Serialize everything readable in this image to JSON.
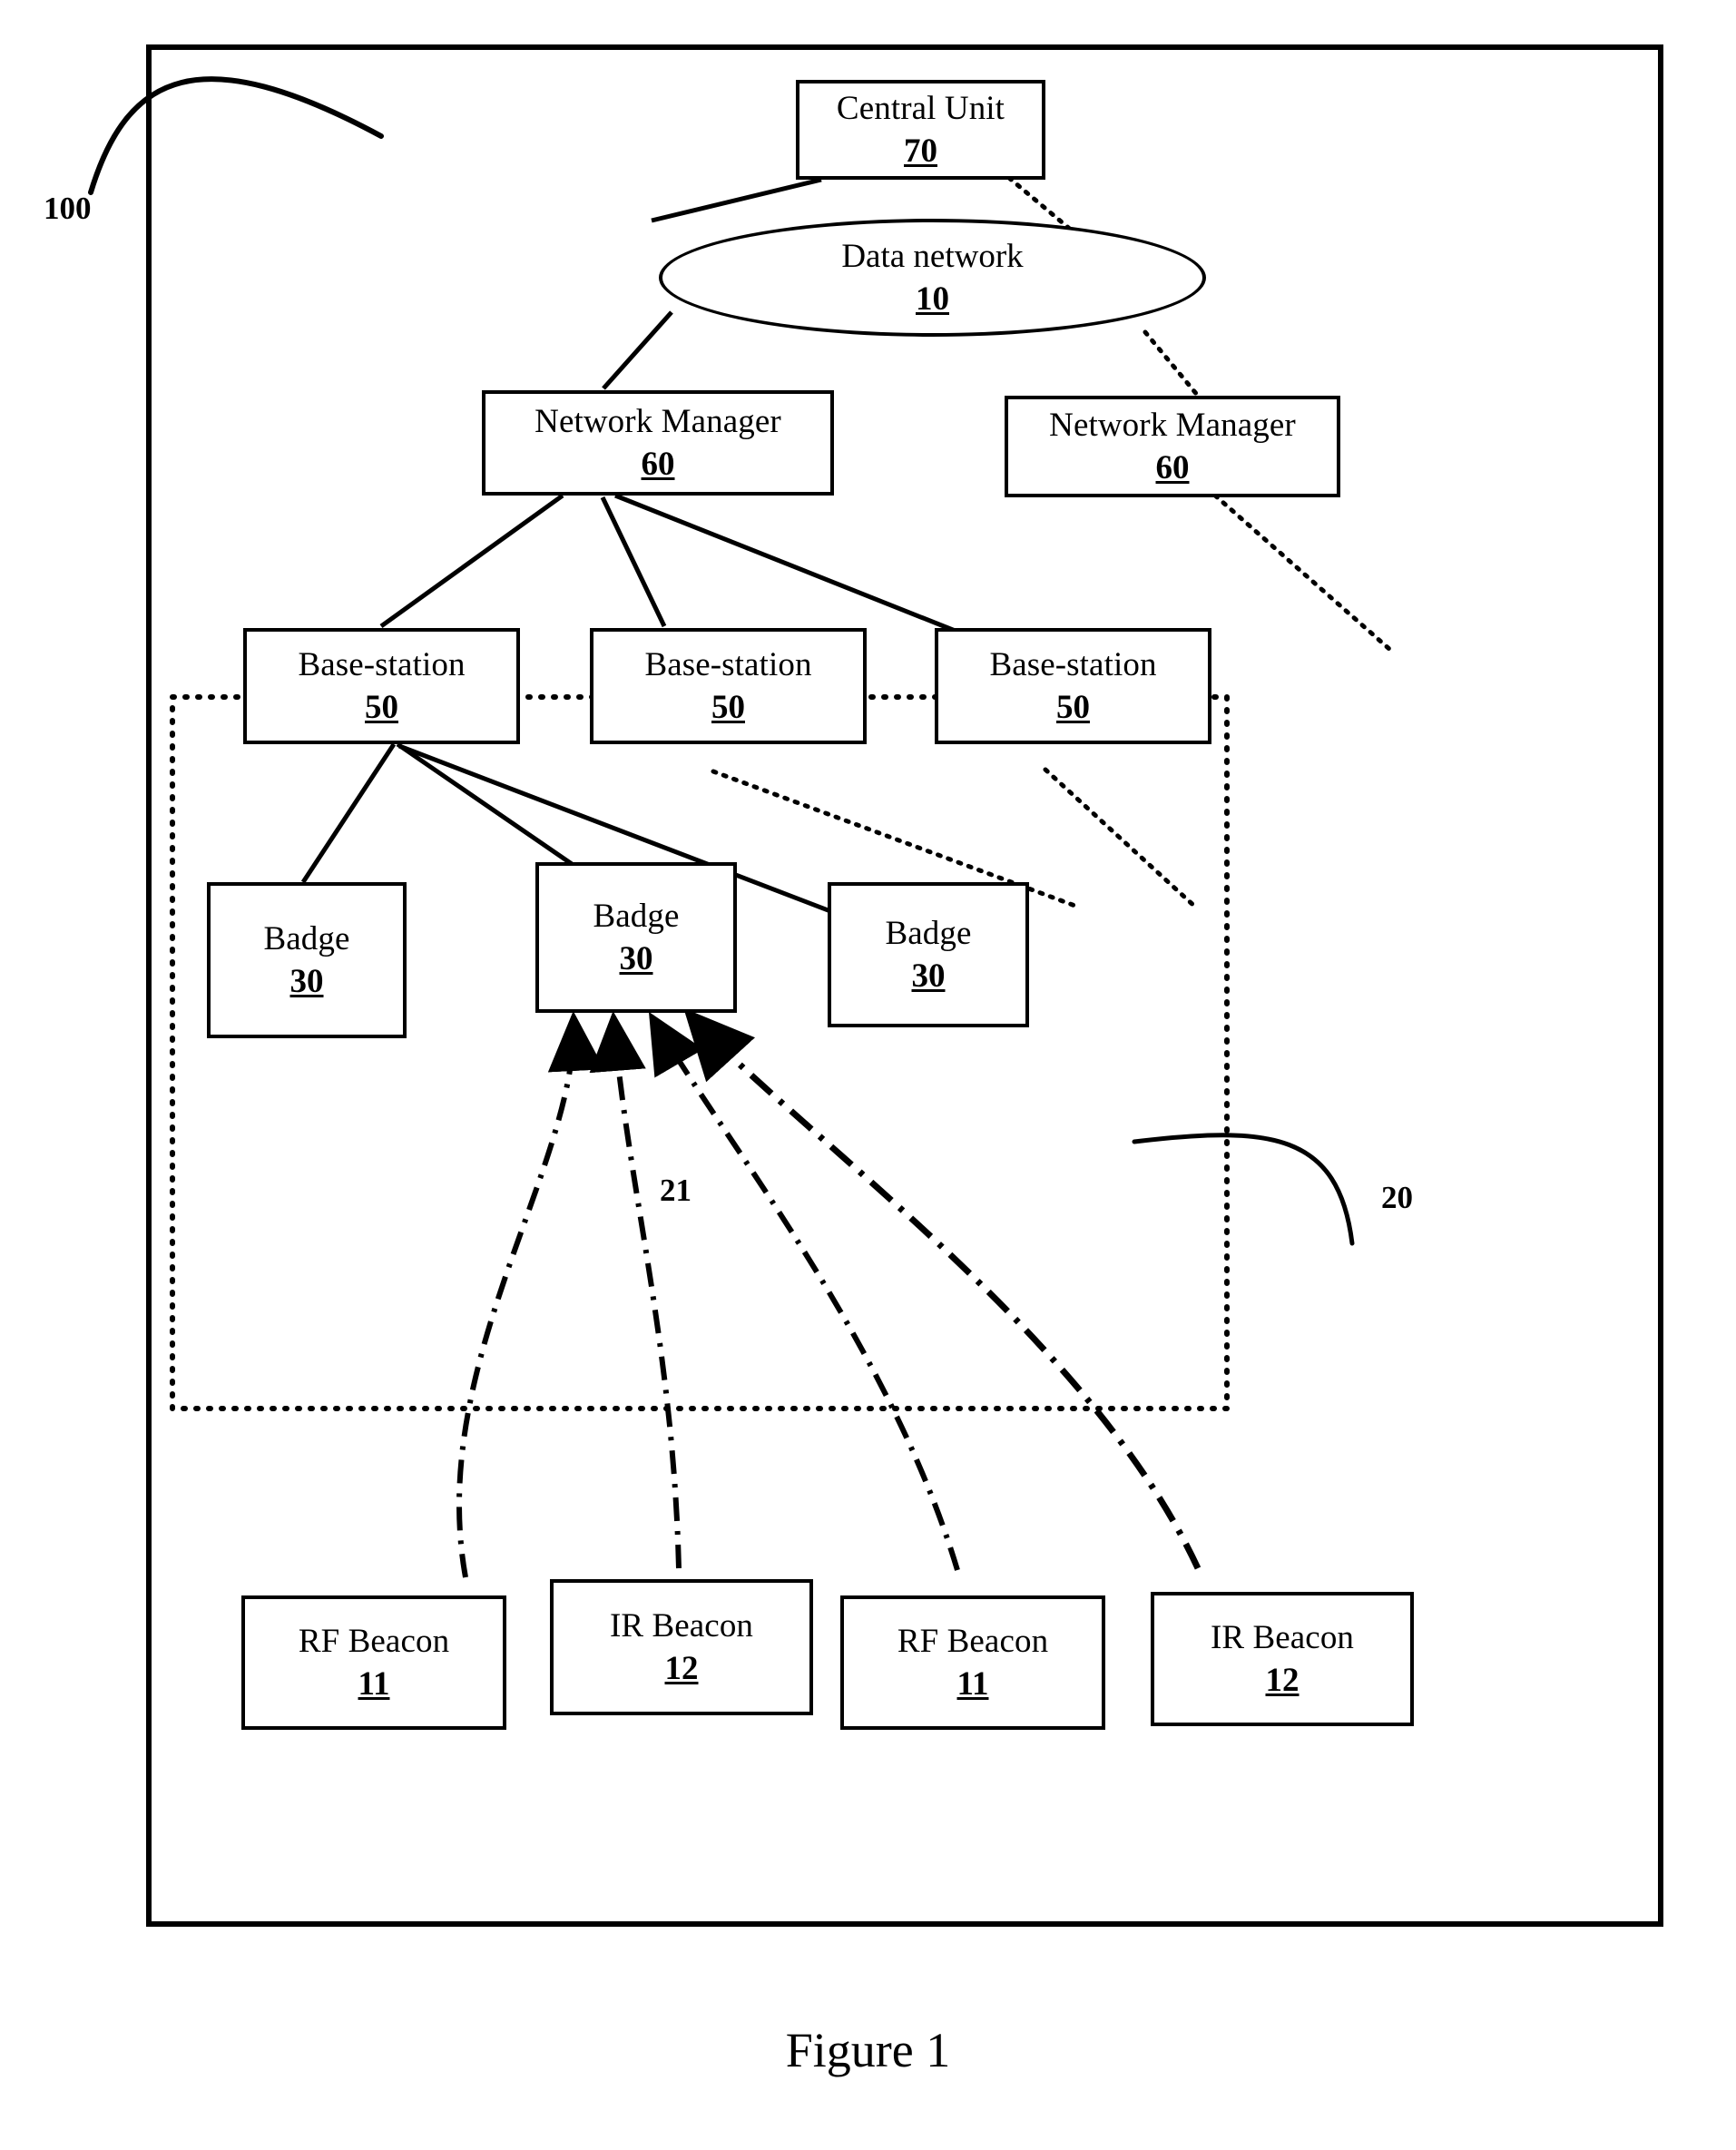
{
  "figure": {
    "caption": "Figure 1",
    "outer_frame_ref": "100",
    "inner_region_ref": "20",
    "beacon_signal_ref": "21"
  },
  "nodes": {
    "central_unit": {
      "title": "Central Unit",
      "number": "70"
    },
    "data_network": {
      "title": "Data network",
      "number": "10"
    },
    "network_manager_left": {
      "title": "Network Manager",
      "number": "60"
    },
    "network_manager_right": {
      "title": "Network Manager",
      "number": "60"
    },
    "base_station_1": {
      "title": "Base-station",
      "number": "50"
    },
    "base_station_2": {
      "title": "Base-station",
      "number": "50"
    },
    "base_station_3": {
      "title": "Base-station",
      "number": "50"
    },
    "badge_1": {
      "title": "Badge",
      "number": "30"
    },
    "badge_2": {
      "title": "Badge",
      "number": "30"
    },
    "badge_3": {
      "title": "Badge",
      "number": "30"
    },
    "rf_beacon_1": {
      "title": "RF Beacon",
      "number": "11"
    },
    "ir_beacon_1": {
      "title": "IR Beacon",
      "number": "12"
    },
    "rf_beacon_2": {
      "title": "RF Beacon",
      "number": "11"
    },
    "ir_beacon_2": {
      "title": "IR Beacon",
      "number": "12"
    }
  },
  "colors": {
    "stroke": "#000000",
    "background": "#ffffff"
  }
}
